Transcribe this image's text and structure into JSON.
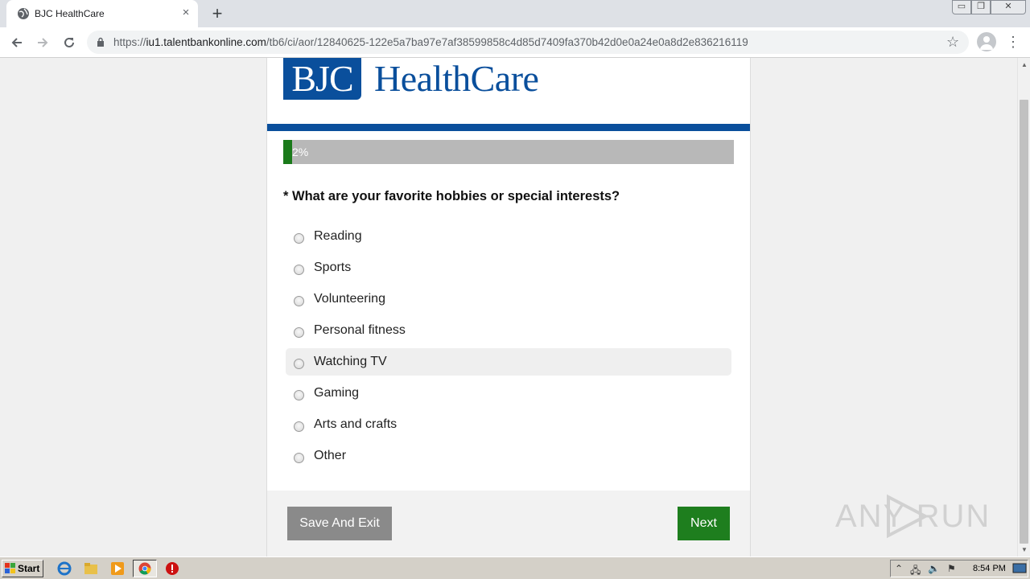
{
  "browser": {
    "tab_title": "BJC HealthCare",
    "tab_close": "×",
    "new_tab": "+",
    "url_prefix": "https://",
    "url_host": "iu1.talentbankonline.com",
    "url_path": "/tb6/ci/aor/12840625-122e5a7ba97e7af38599858c4d85d7409fa370b42d0e0a24e0a8d2e836216119",
    "window_min": "▭",
    "window_max": "❐",
    "window_close": "✕"
  },
  "page": {
    "logo_mark": "BJC",
    "logo_name": "HealthCare",
    "progress_percent": 2,
    "progress_label": "2%",
    "question": "* What are your favorite hobbies or special interests?",
    "options": [
      {
        "label": "Reading"
      },
      {
        "label": "Sports"
      },
      {
        "label": "Volunteering"
      },
      {
        "label": "Personal fitness"
      },
      {
        "label": "Watching TV"
      },
      {
        "label": "Gaming"
      },
      {
        "label": "Arts and crafts"
      },
      {
        "label": "Other"
      }
    ],
    "hovered_option_index": 4,
    "save_button": "Save And Exit",
    "next_button": "Next",
    "watermark": "ANY RUN"
  },
  "taskbar": {
    "start_label": "Start",
    "clock": "8:54 PM"
  },
  "colors": {
    "brand_blue": "#0a4f9c",
    "progress_green": "#1a7a1a",
    "next_green": "#1e7e1e",
    "save_gray": "#8a8a8a"
  }
}
